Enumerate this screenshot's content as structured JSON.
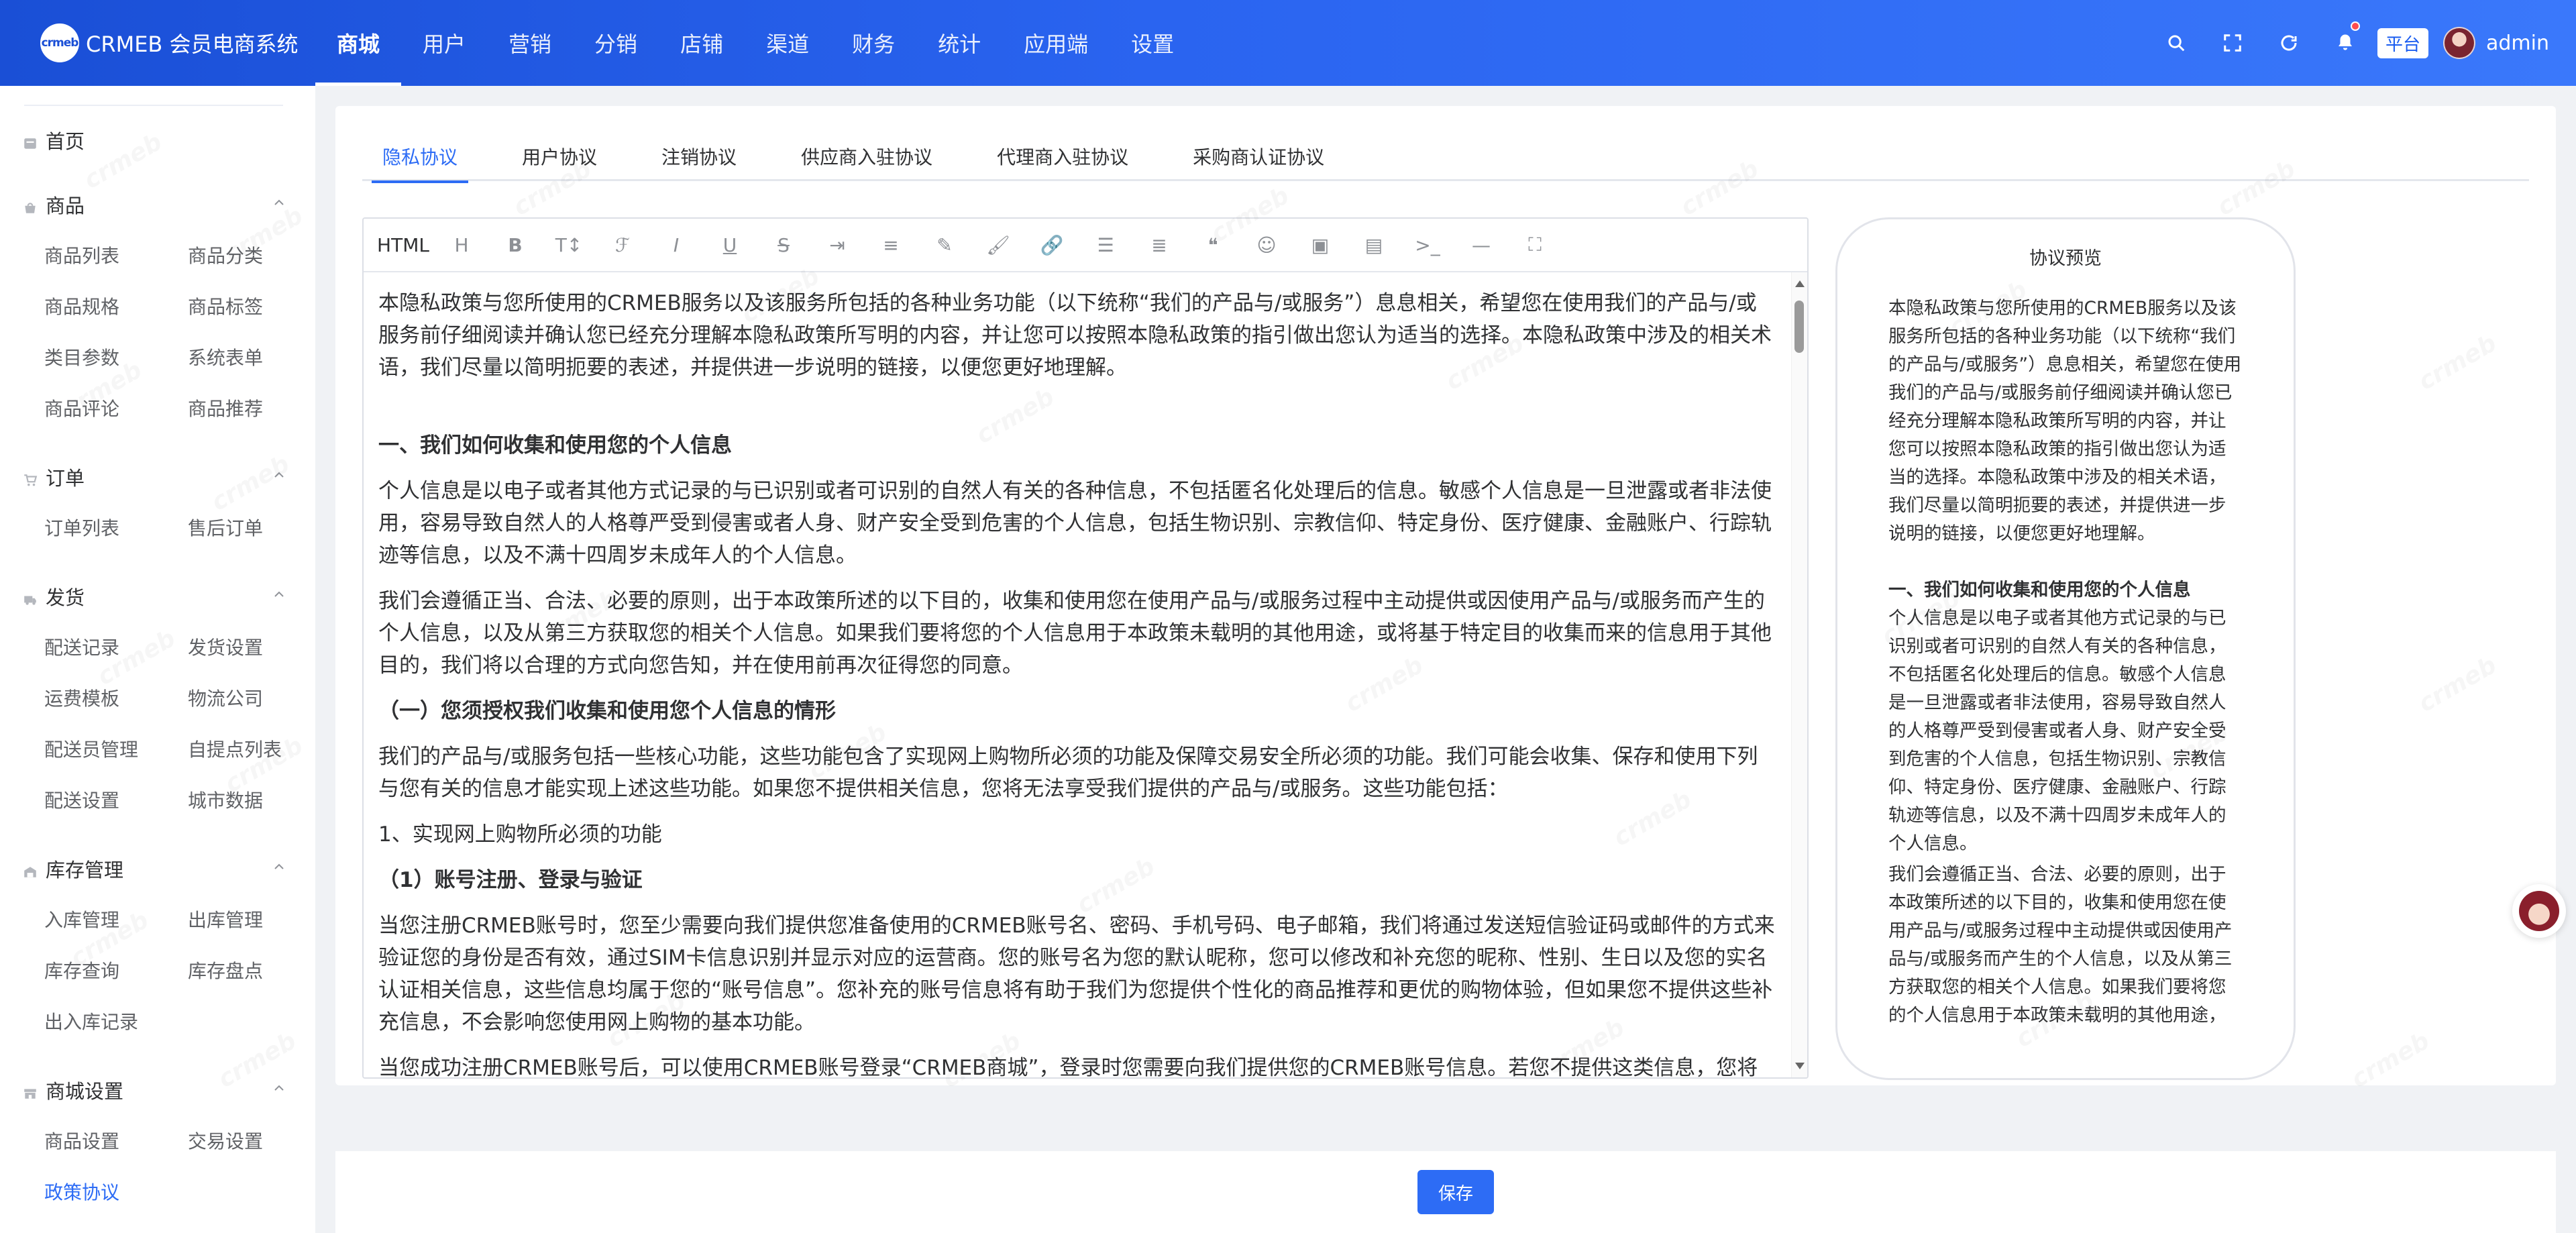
{
  "header": {
    "logo_mark": "crmeb",
    "logo_text": "CRMEB 会员电商系统",
    "nav": [
      "商城",
      "用户",
      "营销",
      "分销",
      "店铺",
      "渠道",
      "财务",
      "统计",
      "应用端",
      "设置"
    ],
    "active_nav": "商城",
    "platform_tag": "平台",
    "username": "admin",
    "icons": [
      "search-icon",
      "fullscreen-icon",
      "refresh-icon",
      "bell-icon"
    ]
  },
  "sidebar": {
    "home": "首页",
    "groups": [
      {
        "title": "商品",
        "icon": "product-icon",
        "items": [
          "商品列表",
          "商品分类",
          "商品规格",
          "商品标签",
          "类目参数",
          "系统表单",
          "商品评论",
          "商品推荐"
        ]
      },
      {
        "title": "订单",
        "icon": "cart-icon",
        "items": [
          "订单列表",
          "售后订单"
        ]
      },
      {
        "title": "发货",
        "icon": "truck-icon",
        "items": [
          "配送记录",
          "发货设置",
          "运费模板",
          "物流公司",
          "配送员管理",
          "自提点列表",
          "配送设置",
          "城市数据"
        ]
      },
      {
        "title": "库存管理",
        "icon": "warehouse-icon",
        "items": [
          "入库管理",
          "出库管理",
          "库存查询",
          "库存盘点",
          "出入库记录"
        ]
      },
      {
        "title": "商城设置",
        "icon": "shop-icon",
        "items": [
          "商品设置",
          "交易设置",
          "政策协议"
        ]
      }
    ],
    "active_item": "政策协议"
  },
  "tabs": [
    "隐私协议",
    "用户协议",
    "注销协议",
    "供应商入驻协议",
    "代理商入驻协议",
    "采购商认证协议"
  ],
  "active_tab": "隐私协议",
  "editor": {
    "toolbar_html_label": "HTML",
    "toolbar_icons": [
      "heading-icon",
      "bold-icon",
      "font-size-icon",
      "font-family-icon",
      "italic-icon",
      "underline-icon",
      "strikethrough-icon",
      "indent-icon",
      "line-height-icon",
      "font-color-icon",
      "background-color-icon",
      "link-icon",
      "list-icon",
      "justify-icon",
      "quote-icon",
      "emoji-icon",
      "image-icon",
      "video-icon",
      "code-icon",
      "divider-icon",
      "fullscreen-icon"
    ],
    "paragraphs": [
      {
        "type": "p",
        "text": "本隐私政策与您所使用的CRMEB服务以及该服务所包括的各种业务功能（以下统称“我们的产品与/或服务”）息息相关，希望您在使用我们的产品与/或服务前仔细阅读并确认您已经充分理解本隐私政策所写明的内容，并让您可以按照本隐私政策的指引做出您认为适当的选择。本隐私政策中涉及的相关术语，我们尽量以简明扼要的表述，并提供进一步说明的链接，以便您更好地理解。"
      },
      {
        "type": "h",
        "text": "一、我们如何收集和使用您的个人信息"
      },
      {
        "type": "p",
        "text": "个人信息是以电子或者其他方式记录的与已识别或者可识别的自然人有关的各种信息，不包括匿名化处理后的信息。敏感个人信息是一旦泄露或者非法使用，容易导致自然人的人格尊严受到侵害或者人身、财产安全受到危害的个人信息，包括生物识别、宗教信仰、特定身份、医疗健康、金融账户、行踪轨迹等信息，以及不满十四周岁未成年人的个人信息。"
      },
      {
        "type": "p",
        "text": "我们会遵循正当、合法、必要的原则，出于本政策所述的以下目的，收集和使用您在使用产品与/或服务过程中主动提供或因使用产品与/或服务而产生的个人信息，以及从第三方获取您的相关个人信息。如果我们要将您的个人信息用于本政策未载明的其他用途，或将基于特定目的收集而来的信息用于其他目的，我们将以合理的方式向您告知，并在使用前再次征得您的同意。"
      },
      {
        "type": "h",
        "text": "（一）您须授权我们收集和使用您个人信息的情形"
      },
      {
        "type": "p",
        "text": "我们的产品与/或服务包括一些核心功能，这些功能包含了实现网上购物所必须的功能及保障交易安全所必须的功能。我们可能会收集、保存和使用下列与您有关的信息才能实现上述这些功能。如果您不提供相关信息，您将无法享受我们提供的产品与/或服务。这些功能包括："
      },
      {
        "type": "p",
        "text": "1、实现网上购物所必须的功能"
      },
      {
        "type": "h",
        "text": "（1）账号注册、登录与验证"
      },
      {
        "type": "p",
        "text": "当您注册CRMEB账号时，您至少需要向我们提供您准备使用的CRMEB账号名、密码、手机号码、电子邮箱，我们将通过发送短信验证码或邮件的方式来验证您的身份是否有效，通过SIM卡信息识别并显示对应的运营商。您的账号名为您的默认昵称，您可以修改和补充您的昵称、性别、生日以及您的实名认证相关信息，这些信息均属于您的“账号信息”。您补充的账号信息将有助于我们为您提供个性化的商品推荐和更优的购物体验，但如果您不提供这些补充信息，不会影响您使用网上购物的基本功能。"
      },
      {
        "type": "p",
        "text": "当您成功注册CRMEB账号后，可以使用CRMEB账号登录“CRMEB商城”，登录时您需要向我们提供您的CRMEB账号信息。若您不提供这类信息，您将无法登录和使用。"
      }
    ]
  },
  "preview": {
    "title": "协议预览",
    "intro": "本隐私政策与您所使用的CRMEB服务以及该服务所包括的各种业务功能（以下统称“我们的产品与/或服务”）息息相关，希望您在使用我们的产品与/或服务前仔细阅读并确认您已经充分理解本隐私政策所写明的内容，并让您可以按照本隐私政策的指引做出您认为适当的选择。本隐私政策中涉及的相关术语，我们尽量以简明扼要的表述，并提供进一步说明的链接，以便您更好地理解。",
    "heading": "一、我们如何收集和使用您的个人信息",
    "p1": "个人信息是以电子或者其他方式记录的与已识别或者可识别的自然人有关的各种信息，不包括匿名化处理后的信息。敏感个人信息是一旦泄露或者非法使用，容易导致自然人的人格尊严受到侵害或者人身、财产安全受到危害的个人信息，包括生物识别、宗教信仰、特定身份、医疗健康、金融账户、行踪轨迹等信息，以及不满十四周岁未成年人的个人信息。",
    "p2": "我们会遵循正当、合法、必要的原则，出于本政策所述的以下目的，收集和使用您在使用产品与/或服务过程中主动提供或因使用产品与/或服务而产生的个人信息，以及从第三方获取您的相关个人信息。如果我们要将您的个人信息用于本政策未载明的其他用途，或将基于特定目的收集而来的信息用于其他目的，我们将以合理的方式向您告知，并在使用前再次征得您的同意。"
  },
  "save_label": "保存",
  "watermark_text": "crmeb",
  "colors": {
    "header_start": "#1a4fd6",
    "header_end": "#3a78fb",
    "accent": "#2d6cf5",
    "badge": "#ff4d4f"
  }
}
